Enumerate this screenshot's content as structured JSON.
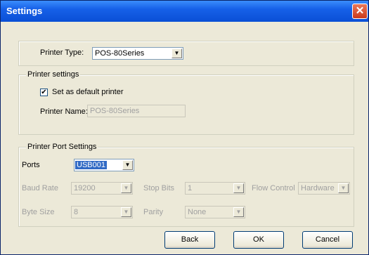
{
  "window": {
    "title": "Settings",
    "close_glyph": "✕"
  },
  "printer_type": {
    "label": "Printer Type:",
    "value": "POS-80Series"
  },
  "printer_settings": {
    "legend": "Printer settings",
    "default_checkbox": {
      "label": "Set as default printer",
      "checked": true
    },
    "printer_name": {
      "label": "Printer Name:",
      "value": "POS-80Series"
    }
  },
  "port_settings": {
    "legend": "Printer Port Settings",
    "ports": {
      "label": "Ports",
      "value": "USB001"
    },
    "baud_rate": {
      "label": "Baud Rate",
      "value": "19200"
    },
    "stop_bits": {
      "label": "Stop Bits",
      "value": "1"
    },
    "flow_control": {
      "label": "Flow Control",
      "value": "Hardware"
    },
    "byte_size": {
      "label": "Byte Size",
      "value": "8"
    },
    "parity": {
      "label": "Parity",
      "value": "None"
    }
  },
  "buttons": {
    "back": "Back",
    "ok": "OK",
    "cancel": "Cancel"
  },
  "icons": {
    "dropdown_arrow": "▼",
    "check_mark": "✔"
  }
}
